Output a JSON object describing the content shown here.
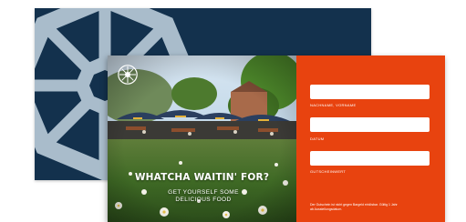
{
  "voucher": {
    "headline": "WHATCHA WAITIN' FOR?",
    "subline": "GET YOURSELF SOME DELICIOUS FOOD",
    "fields": [
      {
        "label": "NACHNAME, VORNAME"
      },
      {
        "label": "DATUM"
      },
      {
        "label": "GUTSCHEINWERT"
      }
    ],
    "fine_print": "Der Gutschein ist nicht gegen Bargeld einlösbar. Gültig 1 Jahr ab Ausstellungsdatum."
  },
  "colors": {
    "navy": "#13314d",
    "orange": "#e8430f",
    "wheel": "#a9bccb"
  },
  "icons": {
    "back_logo": "wheel-emblem-icon",
    "front_logo": "wheel-emblem-icon"
  }
}
